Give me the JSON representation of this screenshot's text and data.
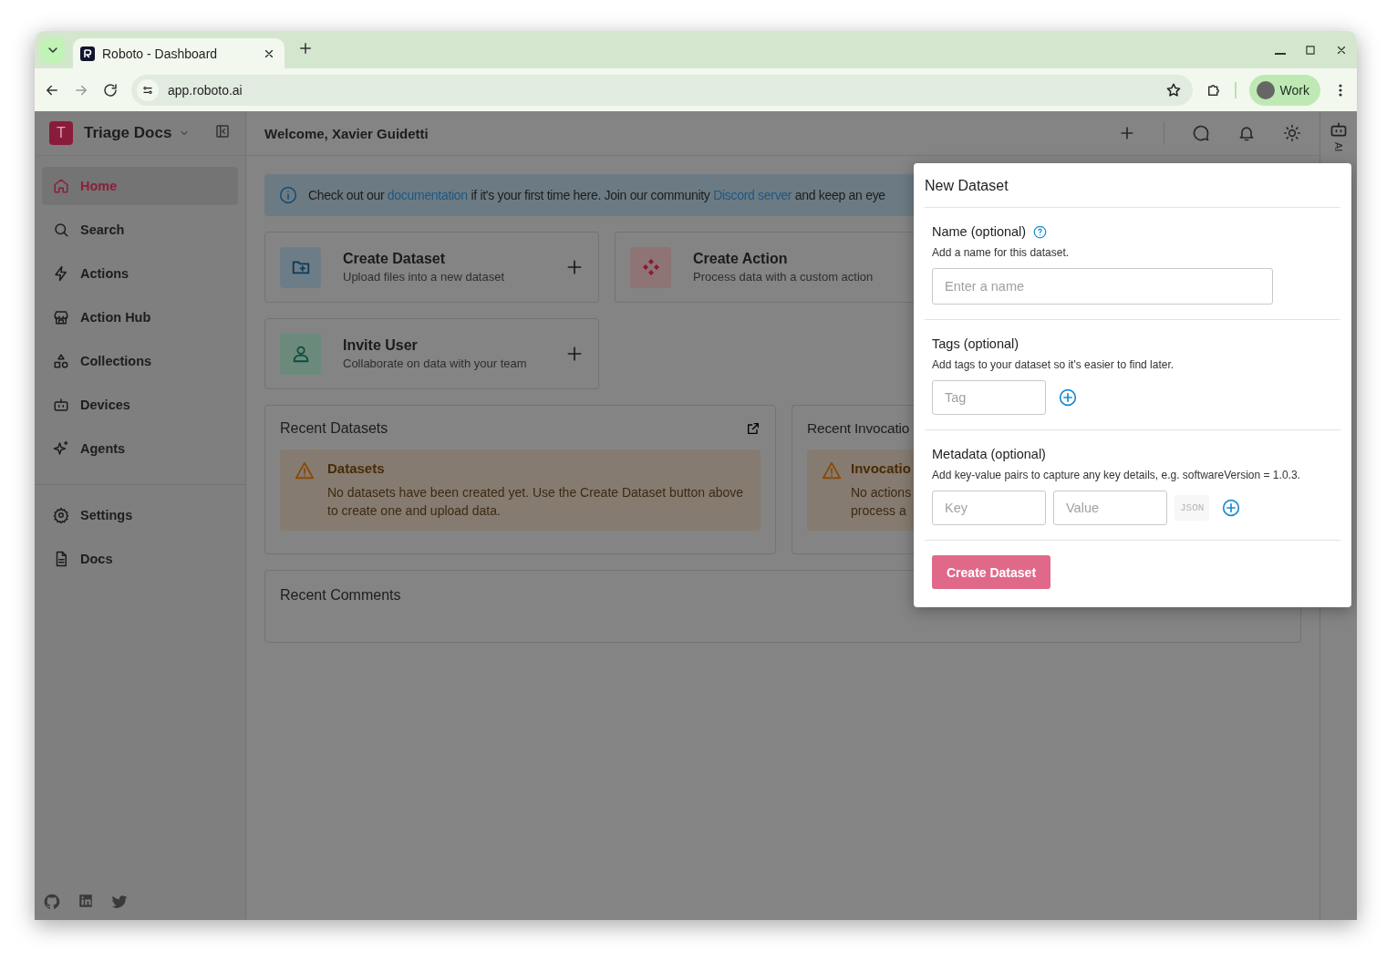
{
  "browser": {
    "tab_title": "Roboto - Dashboard",
    "url": "app.roboto.ai",
    "profile": "Work"
  },
  "sidebar": {
    "workspace_initial": "T",
    "workspace": "Triage Docs",
    "items": [
      {
        "label": "Home",
        "selected": true
      },
      {
        "label": "Search",
        "selected": false
      },
      {
        "label": "Actions",
        "selected": false
      },
      {
        "label": "Action Hub",
        "selected": false
      },
      {
        "label": "Collections",
        "selected": false
      },
      {
        "label": "Devices",
        "selected": false
      },
      {
        "label": "Agents",
        "selected": false
      }
    ],
    "bottom_items": [
      {
        "label": "Settings",
        "selected": false
      },
      {
        "label": "Docs",
        "selected": false
      }
    ]
  },
  "header": {
    "title": "Welcome, Xavier Guidetti"
  },
  "rail": {
    "label": "AI"
  },
  "banner": {
    "parts": [
      {
        "kind": "text",
        "text": "Check out our"
      },
      {
        "kind": "link",
        "text": "documentation"
      },
      {
        "kind": "text",
        "text": "if it's your first time here. Join our community"
      },
      {
        "kind": "link",
        "text": "Discord server"
      },
      {
        "kind": "text",
        "text": "and keep an eye"
      }
    ]
  },
  "quick_actions": [
    {
      "title": "Create Dataset",
      "subtitle": "Upload files into a new dataset"
    },
    {
      "title": "Create Action",
      "subtitle": "Process data with a custom action"
    },
    {
      "title": "Invite User",
      "subtitle": "Collaborate on data with your team"
    }
  ],
  "recent": [
    {
      "title": "Recent Datasets",
      "alert_title": "Datasets",
      "alert_lines": [
        "No datasets have been created yet. Use the Create Dataset button above",
        "to create one and upload data."
      ]
    },
    {
      "title": "Recent Invocatio",
      "alert_title": "Invocatio",
      "alert_lines": [
        "No actions",
        "process a"
      ]
    }
  ],
  "comments": {
    "title": "Recent Comments"
  },
  "modal": {
    "title": "New Dataset",
    "sections": [
      {
        "kind": "name",
        "title": "Name (optional)",
        "description": "Add a name for this dataset.",
        "placeholder": "Enter a name"
      },
      {
        "kind": "tags",
        "title": "Tags (optional)",
        "description": "Add tags to your dataset so it's easier to find later.",
        "placeholder": "Tag"
      },
      {
        "kind": "metadata",
        "title": "Metadata (optional)",
        "description": "Add key-value pairs to capture any key details, e.g. softwareVersion = 1.0.3.",
        "key_placeholder": "Key",
        "value_placeholder": "Value",
        "json_label": "JSON",
        "json_disabled": true
      }
    ],
    "submit": "Create Dataset"
  }
}
